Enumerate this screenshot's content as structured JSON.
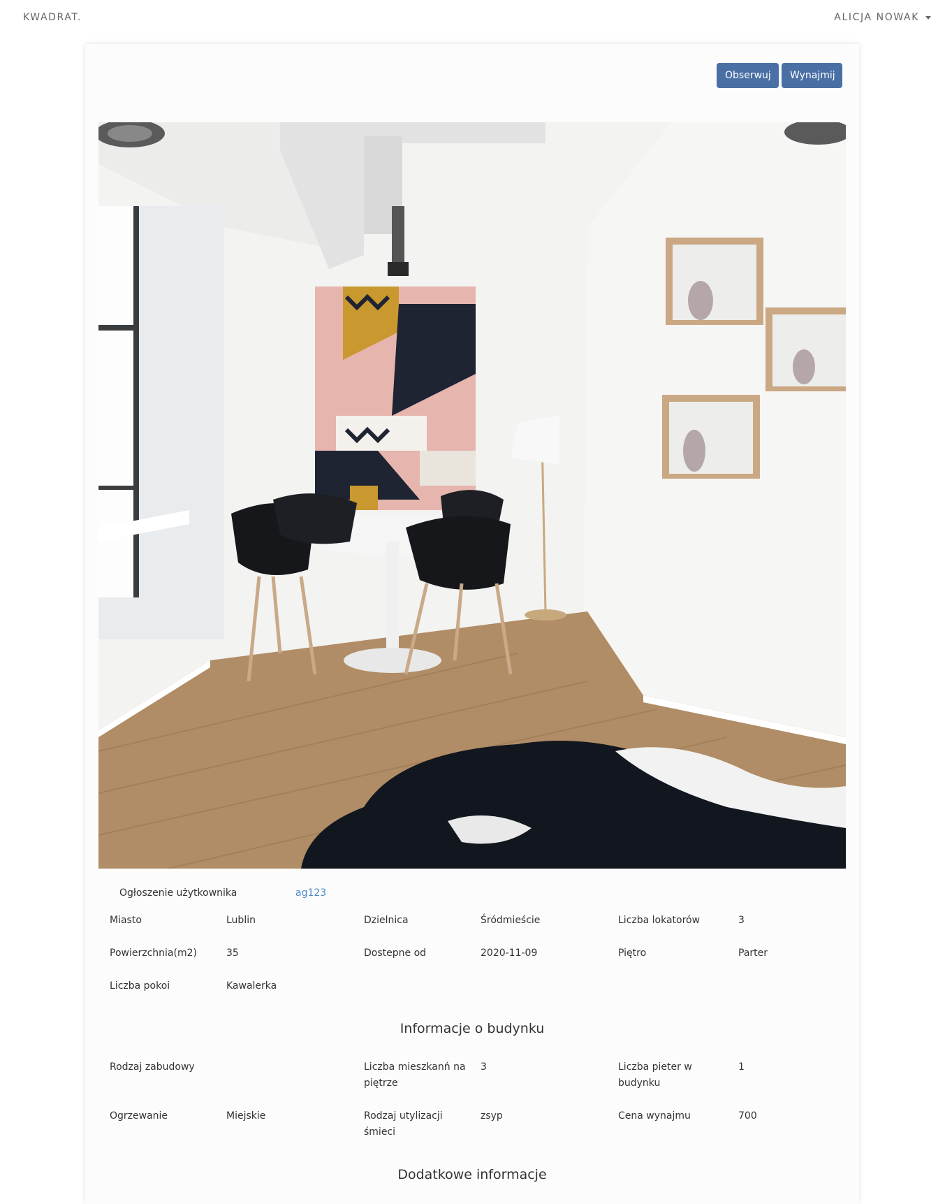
{
  "nav": {
    "brand": "KWADRAT.",
    "user": "ALICJA NOWAK"
  },
  "actions": {
    "follow": "Obserwuj",
    "rent": "Wynajmij"
  },
  "colors": {
    "primary": "#4a6fa5",
    "link": "#4a8bc8"
  },
  "owner": {
    "label": "Ogłoszenie użytkownika",
    "username": "ag123"
  },
  "details": {
    "city_label": "Miasto",
    "city": "Lublin",
    "district_label": "Dzielnica",
    "district": "Śródmieście",
    "tenants_label": "Liczba lokatorów",
    "tenants": "3",
    "area_label": "Powierzchnia(m2)",
    "area": "35",
    "available_label": "Dostepne od",
    "available": "2020-11-09",
    "floor_label": "Piętro",
    "floor": "Parter",
    "rooms_label": "Liczba pokoi",
    "rooms": "Kawalerka"
  },
  "building": {
    "title": "Informacje o budynku",
    "type_label": "Rodzaj zabudowy",
    "type": "",
    "flats_per_floor_label": "Liczba mieszkanń na piętrze",
    "flats_per_floor": "3",
    "floors_label": "Liczba pieter w budynku",
    "floors": "1",
    "heating_label": "Ogrzewanie",
    "heating": "Miejskie",
    "waste_label": "Rodzaj utylizacji śmieci",
    "waste": "zsyp",
    "price_label": "Cena wynajmu",
    "price": "700"
  },
  "extra": {
    "title": "Dodatkowe informacje"
  }
}
